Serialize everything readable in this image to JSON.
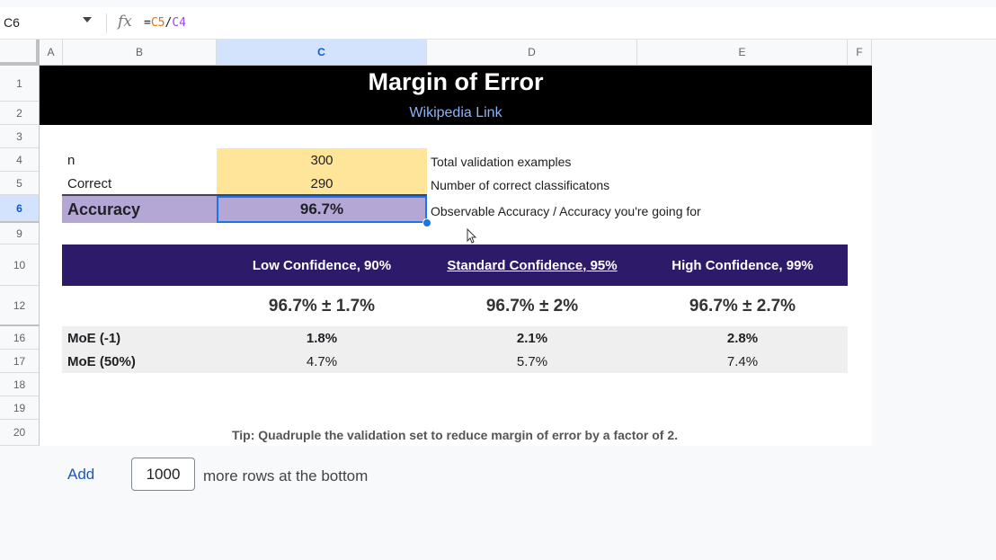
{
  "formula_bar": {
    "cell_ref": "C6",
    "fx_icon": "fx",
    "formula": {
      "eq": "=",
      "ref1": "C5",
      "op": "/",
      "ref2": "C4"
    }
  },
  "columns": [
    "A",
    "B",
    "C",
    "D",
    "E",
    "F"
  ],
  "selected_column": "C",
  "rows": [
    "1",
    "2",
    "3",
    "4",
    "5",
    "6",
    "9",
    "10",
    "12",
    "16",
    "17",
    "18",
    "19",
    "20"
  ],
  "selected_row": "6",
  "sheet": {
    "title": "Margin of Error",
    "link": "Wikipedia Link",
    "inputs": [
      {
        "label": "n",
        "value": "300",
        "desc": "Total validation examples"
      },
      {
        "label": "Correct",
        "value": "290",
        "desc": "Number of correct classificatons"
      }
    ],
    "accuracy": {
      "label": "Accuracy",
      "value": "96.7%",
      "desc": "Observable Accuracy / Accuracy you're going for"
    },
    "confidence_headers": [
      "Low Confidence, 90%",
      "Standard Confidence, 95%",
      "High Confidence, 99%"
    ],
    "ranges": [
      "96.7% ± 1.7%",
      "96.7% ± 2%",
      "96.7% ± 2.7%"
    ],
    "moe_rows": [
      {
        "label": "MoE (-1)",
        "values": [
          "1.8%",
          "2.1%",
          "2.8%"
        ]
      },
      {
        "label": "MoE (50%)",
        "values": [
          "4.7%",
          "5.7%",
          "7.4%"
        ]
      }
    ],
    "tip": "Tip: Quadruple the validation set to reduce margin of error by a factor of 2."
  },
  "add_rows": {
    "button": "Add",
    "count": "1000",
    "suffix": "more rows at the bottom"
  },
  "colors": {
    "accent": "#1a73e8",
    "banner": "#000000",
    "header_purple": "#2d1b69",
    "input_yellow": "#ffe599",
    "accuracy_lavender": "#b4a7d6"
  }
}
